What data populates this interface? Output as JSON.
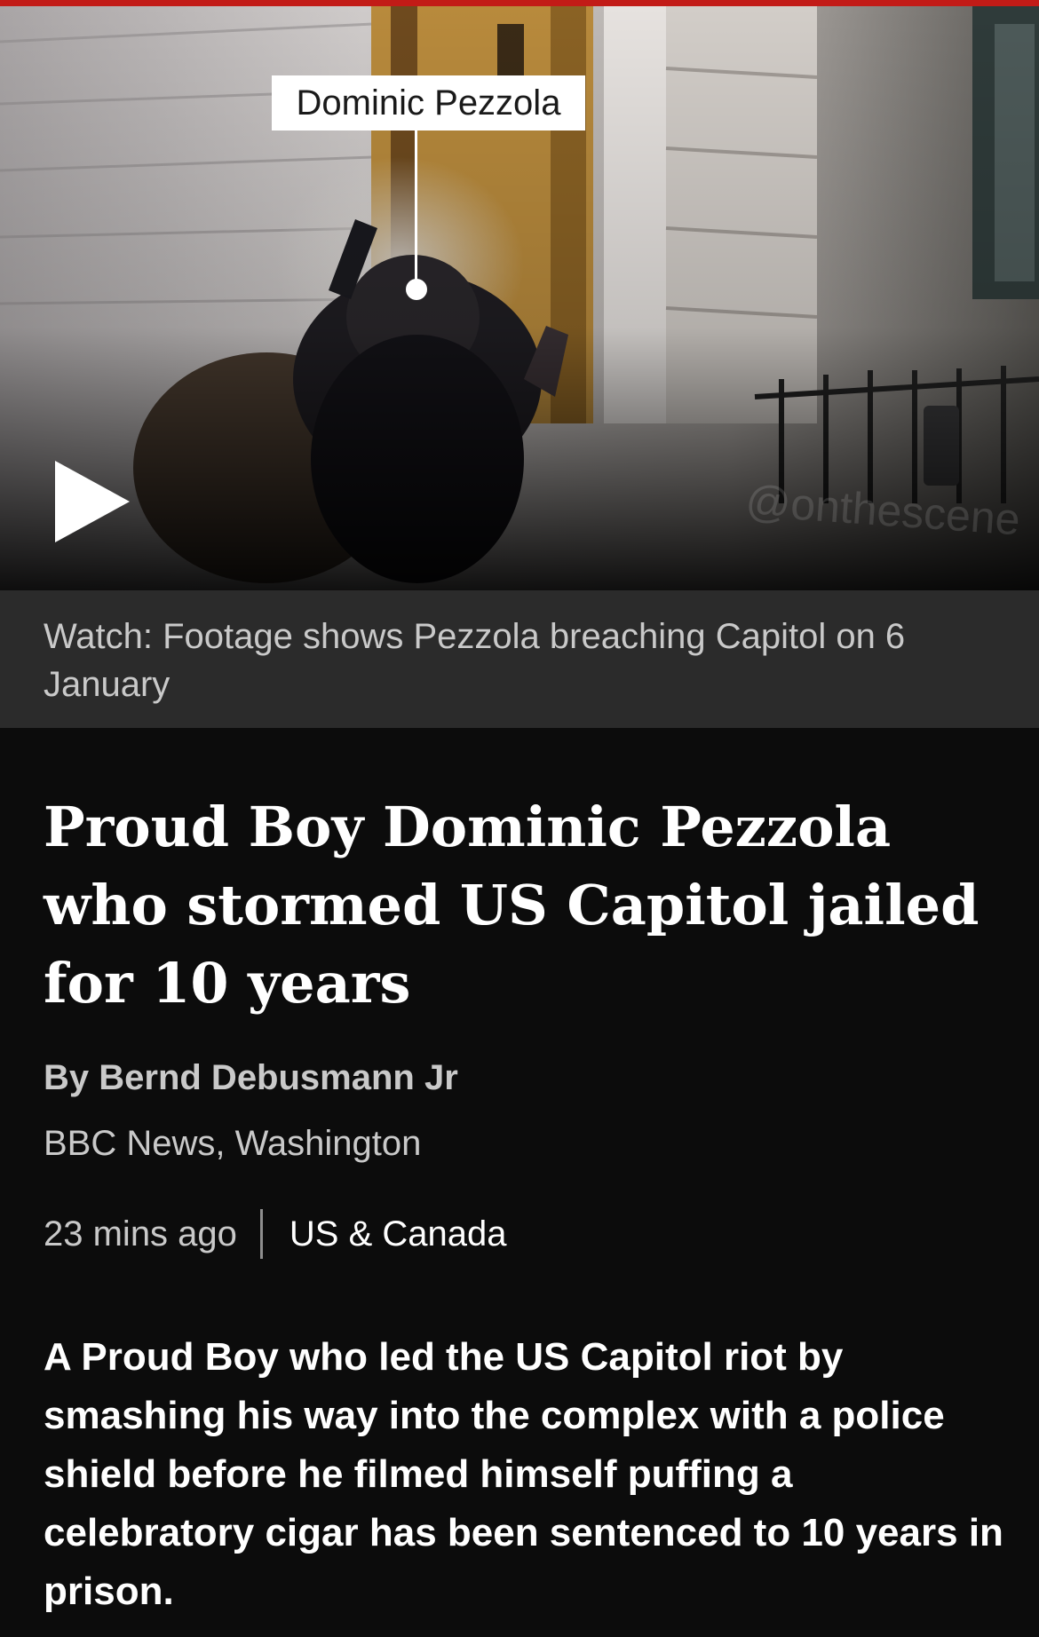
{
  "colors": {
    "accent_bar": "#c21b17",
    "background": "#0c0c0c",
    "caption_background": "#2b2b2b"
  },
  "video": {
    "name_label": "Dominic Pezzola",
    "watermark": "@onthescene",
    "play_icon": "play-icon"
  },
  "caption": {
    "text": "Watch: Footage shows Pezzola breaching Capitol on 6 January"
  },
  "article": {
    "headline": "Proud Boy Dominic Pezzola who stormed US Capitol jailed for 10 years",
    "byline": "By Bernd Debusmann Jr",
    "byline_org": "BBC News, Washington",
    "timestamp": "23 mins ago",
    "section": "US & Canada",
    "summary": "A Proud Boy who led the US Capitol riot by smashing his way into the complex with a police shield before he filmed himself puffing a celebratory cigar has been sentenced to 10 years in prison."
  }
}
